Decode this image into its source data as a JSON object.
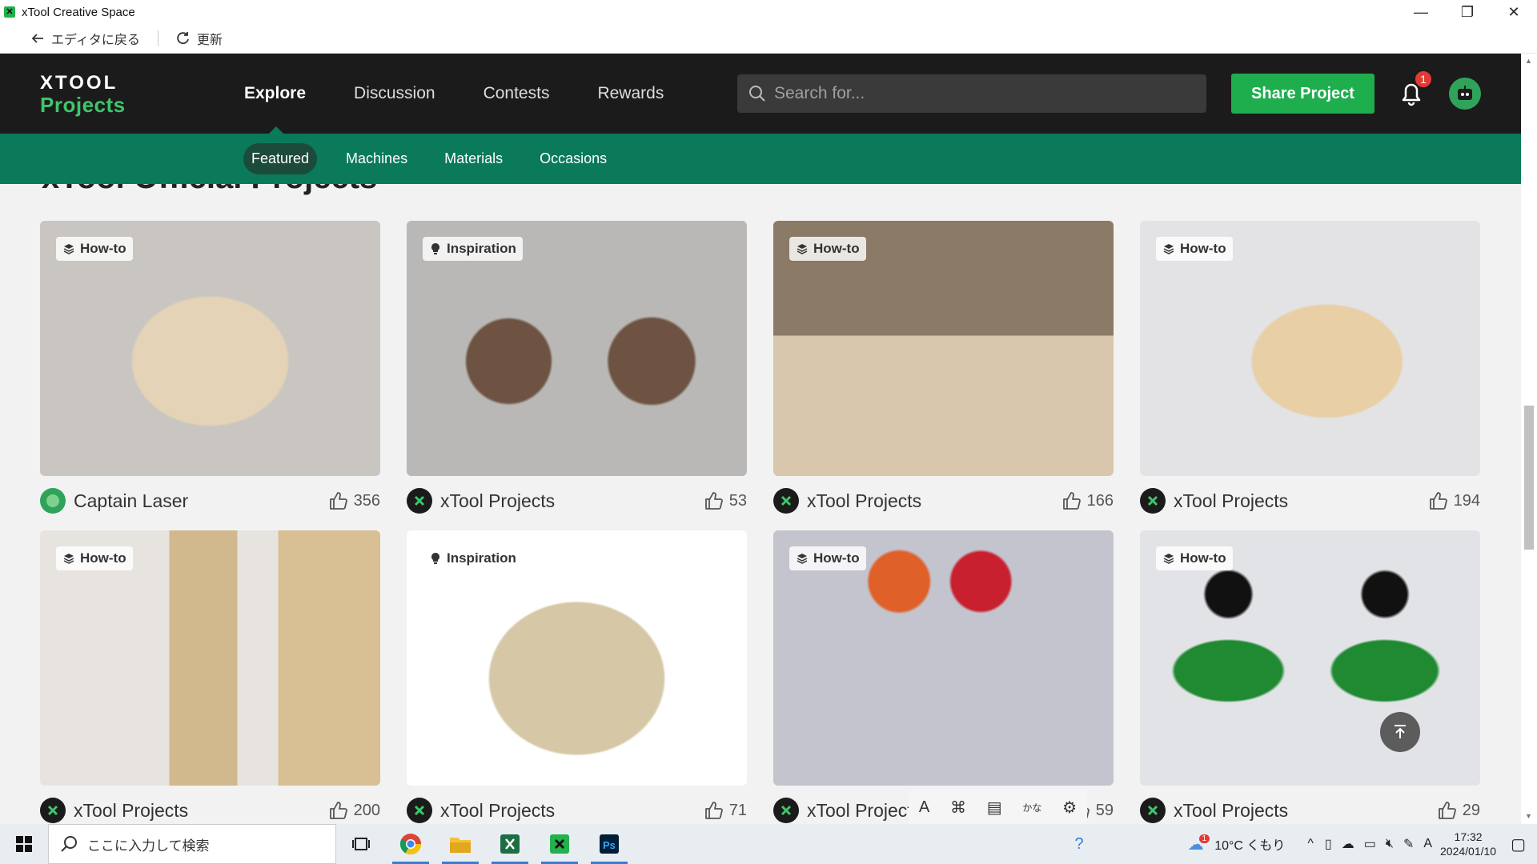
{
  "window": {
    "title": "xTool Creative Space",
    "controls": [
      "—",
      "❐",
      "✕"
    ]
  },
  "editor_bar": {
    "back_label": "エディタに戻る",
    "refresh_label": "更新"
  },
  "header": {
    "logo_line1": "XTOOL",
    "logo_line2": "Projects",
    "nav": [
      "Explore",
      "Discussion",
      "Contests",
      "Rewards"
    ],
    "search_placeholder": "Search for...",
    "share_label": "Share Project",
    "notification_count": "1"
  },
  "subnav": [
    "Featured",
    "Machines",
    "Materials",
    "Occasions"
  ],
  "section_title": "xTool Official Projects",
  "cards": [
    {
      "tag": "How-to",
      "tag_icon": "layers-icon",
      "author": "Captain Laser",
      "likes": "356",
      "bg": "#c9c6c2"
    },
    {
      "tag": "Inspiration",
      "tag_icon": "bulb-icon",
      "author": "xTool Projects",
      "likes": "53",
      "bg": "#b9b8b6"
    },
    {
      "tag": "How-to",
      "tag_icon": "layers-icon",
      "author": "xTool Projects",
      "likes": "166",
      "bg": "#c8b59a"
    },
    {
      "tag": "How-to",
      "tag_icon": "layers-icon",
      "author": "xTool Projects",
      "likes": "194",
      "bg": "#e3e3e5"
    },
    {
      "tag": "How-to",
      "tag_icon": "layers-icon",
      "author": "xTool Projects",
      "likes": "200",
      "bg": "#e7e4e0"
    },
    {
      "tag": "Inspiration",
      "tag_icon": "bulb-icon",
      "author": "xTool Projects",
      "likes": "71",
      "bg": "#ffffff"
    },
    {
      "tag": "How-to",
      "tag_icon": "layers-icon",
      "author": "xTool Project",
      "likes": "59",
      "bg": "#c3c4cd"
    },
    {
      "tag": "How-to",
      "tag_icon": "layers-icon",
      "author": "xTool Projects",
      "likes": "29",
      "bg": "#e1e3e6"
    }
  ],
  "taskbar": {
    "search_placeholder": "ここに入力して検索",
    "weather": "10°C くもり",
    "weather_badge": "1",
    "ime_label": "A",
    "time": "17:32",
    "date": "2024/01/10"
  },
  "colors": {
    "accent_green": "#1fae4e",
    "subnav_green": "#0a7a5a",
    "header_dark": "#1b1b1b"
  }
}
